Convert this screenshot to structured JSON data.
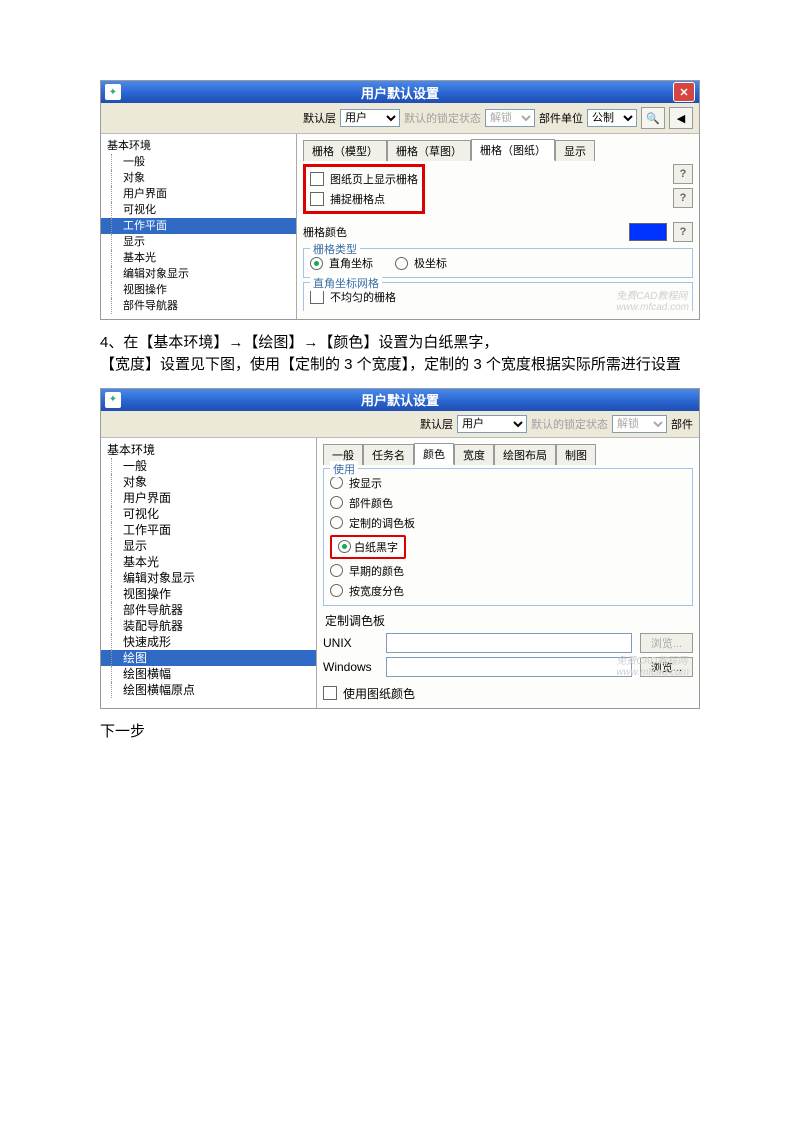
{
  "dialog1": {
    "title": "用户默认设置",
    "toolbar": {
      "default_layer_label": "默认层",
      "default_layer_value": "用户",
      "lock_state_label": "默认的锁定状态",
      "lock_state_value": "解锁",
      "part_unit_label": "部件单位",
      "part_unit_value": "公制"
    },
    "tree_root": "基本环境",
    "tree_items": [
      "一般",
      "对象",
      "用户界面",
      "可视化",
      "工作平面",
      "显示",
      "基本光",
      "编辑对象显示",
      "视图操作",
      "部件导航器"
    ],
    "tree_selected": "工作平面",
    "tabs": [
      "栅格（模型）",
      "栅格（草图）",
      "栅格（图纸）",
      "显示"
    ],
    "active_tab": 2,
    "check1": "图纸页上显示栅格",
    "check2": "捕捉栅格点",
    "color_label": "栅格颜色",
    "group_type_title": "栅格类型",
    "type_opt1": "直角坐标",
    "type_opt2": "极坐标",
    "group_rect_title": "直角坐标网格",
    "rect_opt1": "不均匀的栅格",
    "watermark1": "免费CAD教程网",
    "watermark2": "www.mfcad.com"
  },
  "paragraph": {
    "line1": "4、在【基本环境】→【绘图】→【颜色】设置为白纸黑字，",
    "line2": "【宽度】设置见下图，使用【定制的 3 个宽度】，定制的 3 个宽度根据实际所需进行设置"
  },
  "dialog2": {
    "title": "用户默认设置",
    "toolbar": {
      "default_layer_label": "默认层",
      "default_layer_value": "用户",
      "lock_state_label": "默认的锁定状态",
      "lock_state_value": "解锁",
      "part_label": "部件"
    },
    "tree_root": "基本环境",
    "tree_items": [
      "一般",
      "对象",
      "用户界面",
      "可视化",
      "工作平面",
      "显示",
      "基本光",
      "编辑对象显示",
      "视图操作",
      "部件导航器",
      "装配导航器",
      "快速成形",
      "绘图",
      "绘图横幅",
      "绘图横幅原点"
    ],
    "tree_selected": "绘图",
    "tabs": [
      "一般",
      "任务名",
      "颜色",
      "宽度",
      "绘图布局",
      "制图"
    ],
    "active_tab": 2,
    "use_title": "使用",
    "use_opts": [
      "按显示",
      "部件颜色",
      "定制的调色板",
      "白纸黑字",
      "早期的颜色",
      "按宽度分色"
    ],
    "use_selected": 3,
    "palette_title": "定制调色板",
    "unix_label": "UNIX",
    "windows_label": "Windows",
    "browse_label": "浏览...",
    "use_paper_color": "使用图纸颜色",
    "watermark1": "免费CAD教程网",
    "watermark2": "www.mfcad.com"
  },
  "next_step": "下一步"
}
